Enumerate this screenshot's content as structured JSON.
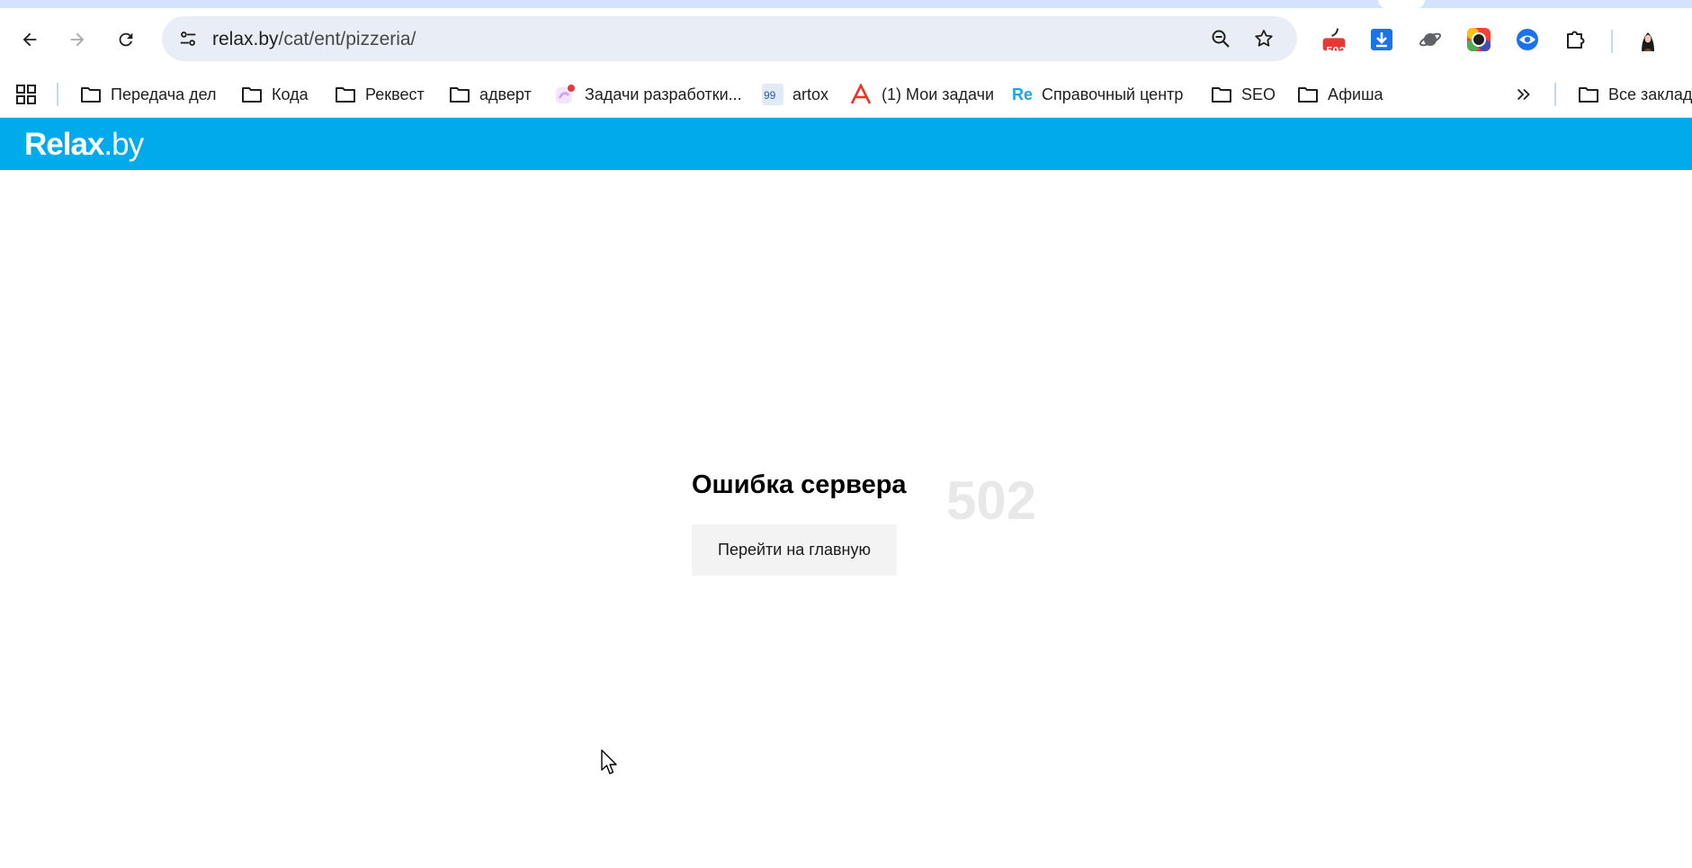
{
  "browser": {
    "url_host": "relax.by",
    "url_path": "/cat/ent/pizzeria/",
    "extensions": [
      {
        "name": "502-badge-extension-icon",
        "badge": "502"
      },
      {
        "name": "download-extension-icon"
      },
      {
        "name": "planet-extension-icon"
      },
      {
        "name": "color-picker-extension-icon"
      },
      {
        "name": "eye-extension-icon"
      },
      {
        "name": "extensions-puzzle-icon"
      }
    ],
    "bookmarks": [
      {
        "label": "Передача дел",
        "icon": "folder-icon"
      },
      {
        "label": "Кода",
        "icon": "folder-icon"
      },
      {
        "label": "Реквест",
        "icon": "folder-icon"
      },
      {
        "label": "адверт",
        "icon": "folder-icon"
      },
      {
        "label": "Задачи разработки...",
        "icon": "tasks-app-icon"
      },
      {
        "label": "artox",
        "icon": "artox-icon",
        "icon_text": "99"
      },
      {
        "label": "(1) Мои задачи",
        "icon": "alfa-icon"
      },
      {
        "label": "Справочный центр",
        "icon": "re-icon",
        "icon_text": "Re"
      },
      {
        "label": "SEO",
        "icon": "folder-icon"
      },
      {
        "label": "Афиша",
        "icon": "folder-icon"
      }
    ],
    "all_bookmarks_label": "Все заклад",
    "colors": {
      "omnibox_bg": "#e9eef6",
      "badge_red": "#e53935",
      "accent_blue": "#1a73e8"
    }
  },
  "site": {
    "logo_bold": "Relax",
    "logo_light": ".by",
    "header_color": "#00aaeb"
  },
  "error": {
    "title": "Ошибка сервера",
    "code": "502",
    "home_button": "Перейти на главную"
  }
}
